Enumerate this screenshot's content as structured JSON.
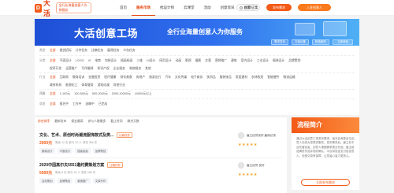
{
  "header": {
    "logo_mark": "D",
    "logo_text": "大活",
    "logo_slogan": "全行业海量创意人为你服务",
    "nav": [
      "首页",
      "服务市场",
      "找设计师",
      "云课堂",
      "活动",
      "创意资讯",
      "创意征集"
    ],
    "nav_active_index": 1,
    "search_label": "搜索",
    "login_label": "发布需求",
    "publish_label": "入驻创意人"
  },
  "banner": {
    "title": "大活创意工场",
    "subtitle": "全行业海量创意人为你服务",
    "boxes": [
      "需求发布",
      "方案征集",
      "精选服务",
      "立即体验"
    ]
  },
  "filters": {
    "row1": {
      "label": "类型",
      "options": [
        "全部",
        "悬赏招标",
        "计件任务",
        "比稿任务",
        "雇佣任务",
        "众包任务"
      ]
    },
    "row2": {
      "label": "分类",
      "options": [
        "全部",
        "平面设计",
        "LOGO",
        "VI",
        "电商",
        "包装设计",
        "插画绘画",
        "三维",
        "UI设计",
        "网页设计",
        "动画",
        "影视",
        "摄影",
        "文案",
        "营销推广",
        "建筑",
        "室内设计",
        "工业设计",
        "服装设计",
        "品牌策划"
      ]
    },
    "row2b": {
      "options": [
        "程序开发",
        "运营推广",
        "写作翻译",
        "知识产权",
        "企业服务",
        "装修服务",
        "其他"
      ]
    },
    "row3": {
      "label": "行业",
      "options": [
        "全部",
        "互联网",
        "教育培训",
        "金融投资",
        "医疗健康",
        "餐饮美食",
        "房地产",
        "旅游出行",
        "汽车",
        "文化传媒",
        "电子商务",
        "快消品",
        "服装饰品",
        "家居建材",
        "农林牧渔",
        "智能硬件",
        "物流运输"
      ]
    },
    "row3b": {
      "options": [
        "政府机构",
        "能源化工",
        "体育健身",
        "游戏动漫",
        "其他行业"
      ]
    },
    "row4": {
      "label": "预算",
      "options": [
        "全部",
        "1-100元",
        "100-500元",
        "500-2000元",
        "2000-10000元",
        "10000元以上"
      ]
    },
    "row5": {
      "label": "状态",
      "options": [
        "全部",
        "报名中",
        "工作中",
        "选稿中",
        "已完成"
      ]
    }
  },
  "list": {
    "sort": [
      "综合排序",
      "最新发布",
      "佣金最高",
      "参与人数最多",
      "截止时间",
      "剩余天数"
    ],
    "tasks": [
      {
        "title": "文化、艺术、原创时尚潮流服饰款式及类...",
        "tag": "比稿任务",
        "price": "2000元",
        "meta": "剩余 12 天   参与 20 人   浏览 356 次",
        "chips": [
          "服装设计",
          "平面设计",
          "插画绘画",
          "品牌策划"
        ],
        "shop": "雇主信誉良好 雇佣记录",
        "stars": "★★★★★"
      },
      {
        "title": "2020中国高尔夫5551邀约赛策划方案",
        "tag": "比稿任务",
        "price": "5000元",
        "meta": "剩余 8 天   参与 15 人   浏览 268 次",
        "chips": [
          "活动策划",
          "品牌策划",
          "营销推广",
          "文案写作"
        ],
        "shop": "雇主信誉 良好",
        "stars": "★★★★★"
      }
    ]
  },
  "panel": {
    "title": "流程简介",
    "text": "通过大活创意工场发布需求，每天会有数百位创意人在线为您提供服务。发布需求后，雇主在平台托管赏金，创意人根据需求提交作品，雇主挑选满意作品并验收确认，平台将赏金支付给创意人，全程交易有保障，让您省心省力更放心。",
    "button": "立即发布需求"
  }
}
